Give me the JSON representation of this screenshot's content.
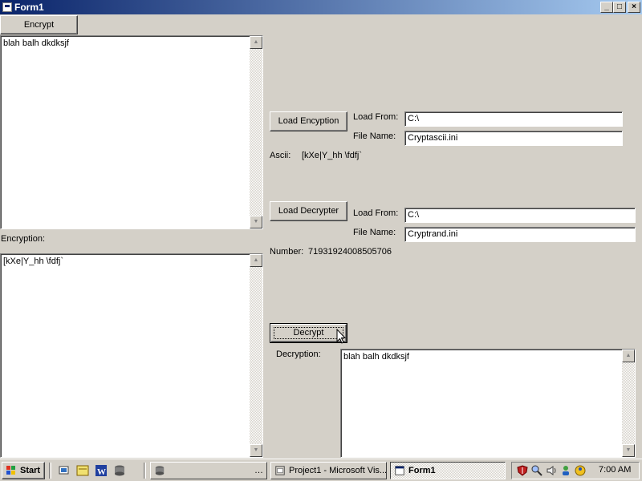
{
  "window": {
    "title": "Form1",
    "controls": {
      "minimize": "_",
      "maximize": "□",
      "close": "×"
    }
  },
  "left": {
    "encrypt_label": "Encrypt",
    "input_text": "blah balh dkdksjf",
    "encryption_label": "Encryption:",
    "encryption_text": "[kXe|Y_hh \\fdfj`"
  },
  "encryption_panel": {
    "load_button": "Load Encyption",
    "load_from_label": "Load From:",
    "load_from_value": "C:\\",
    "file_name_label": "File Name:",
    "file_name_value": "Cryptascii.ini",
    "ascii_label": "Ascii:",
    "ascii_value": "[kXe|Y_hh \\fdfj`"
  },
  "decrypter_panel": {
    "load_button": "Load Decrypter",
    "load_from_label": "Load From:",
    "load_from_value": "C:\\",
    "file_name_label": "File Name:",
    "file_name_value": "Cryptrand.ini",
    "number_label": "Number:",
    "number_value": "71931924008505706"
  },
  "decrypt": {
    "button": "Decrypt",
    "label": "Decryption:",
    "output_text": "blah balh dkdksjf"
  },
  "taskbar": {
    "start_label": "Start",
    "quicklaunch_icons": [
      "desktop-icon",
      "calendar-icon",
      "word-icon",
      "database-icon"
    ],
    "tasks": [
      {
        "label": "",
        "icon": "database-icon"
      },
      {
        "label": "Project1 - Microsoft Vis...",
        "icon": "vb-project-icon"
      },
      {
        "label": "Form1",
        "icon": "form-icon"
      }
    ],
    "tray_icons": [
      "shield-icon",
      "magnifier-icon",
      "speaker-icon",
      "network-users-icon",
      "messenger-icon"
    ],
    "clock": "7:00 AM"
  },
  "colors": {
    "titlebar_start": "#0a246a",
    "titlebar_end": "#a6caf0",
    "face": "#d4d0c8"
  }
}
